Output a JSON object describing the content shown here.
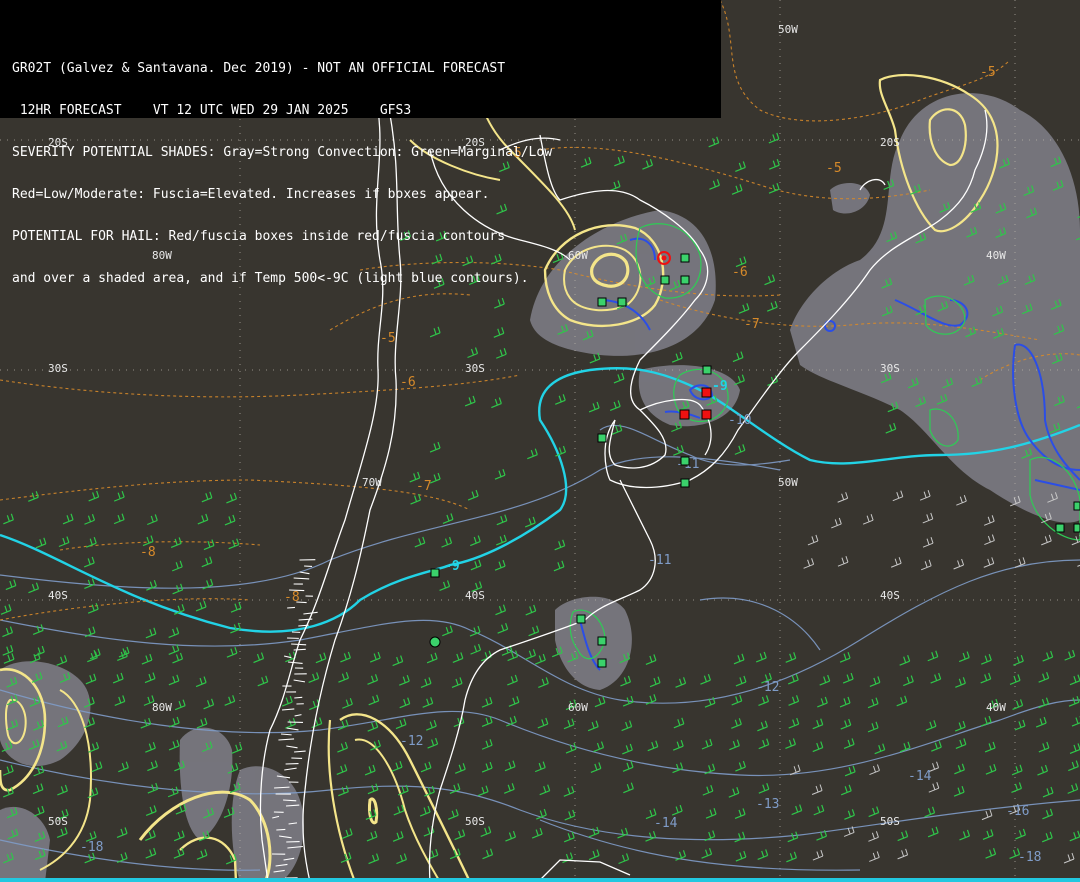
{
  "header": {
    "lines": [
      "GR02T (Galvez & Santavana. Dec 2019) - NOT AN OFFICIAL FORECAST",
      " 12HR FORECAST    VT 12 UTC WED 29 JAN 2025    GFS3",
      "SEVERITY POTENTIAL SHADES: Gray=Strong Convection: Green=Marginal/Low",
      "Red=Low/Moderate: Fuscia=Elevated. Increases if boxes appear.",
      "POTENTIAL FOR HAIL: Red/fuscia boxes inside red/fuscia contours",
      "and over a shaded area, and if Temp 500<-9C (light blue contours)."
    ]
  },
  "grid_labels": {
    "lat_20s": "20S",
    "lat_30s": "30S",
    "lat_40s": "40S",
    "lat_50s": "50S",
    "lon_80w": "80W",
    "lon_70w": "70W",
    "lon_60w": "60W",
    "lon_50w": "50W",
    "lon_40w": "40W"
  },
  "contour_labels": {
    "c_m5": "-5",
    "c_m6": "-6",
    "c_m7": "-7",
    "c_m8": "-8",
    "c_m9": "-9",
    "c_m10": "-10",
    "c_m11": "-11",
    "c_m12": "-12",
    "c_m13": "-13",
    "c_m14": "-14",
    "c_m16": "-16",
    "c_m18": "-18"
  },
  "colors": {
    "background": "#38352f",
    "gray_shade": "#8a8a96",
    "yellow_contour": "#f4e58a",
    "orange_dashed": "#d78a2a",
    "light_blue_temp": "#22d3e6",
    "steelblue_isotherm": "#7f9cc8",
    "blue_contour": "#2b4ee6",
    "green_contour": "#2ecc55",
    "green_box": "#3bd16b",
    "red_box": "#ee1111",
    "wind_barb": "#2fc64a",
    "coastline": "#ffffff"
  },
  "hail_boxes": {
    "green_count": 19,
    "red_count": 4
  }
}
